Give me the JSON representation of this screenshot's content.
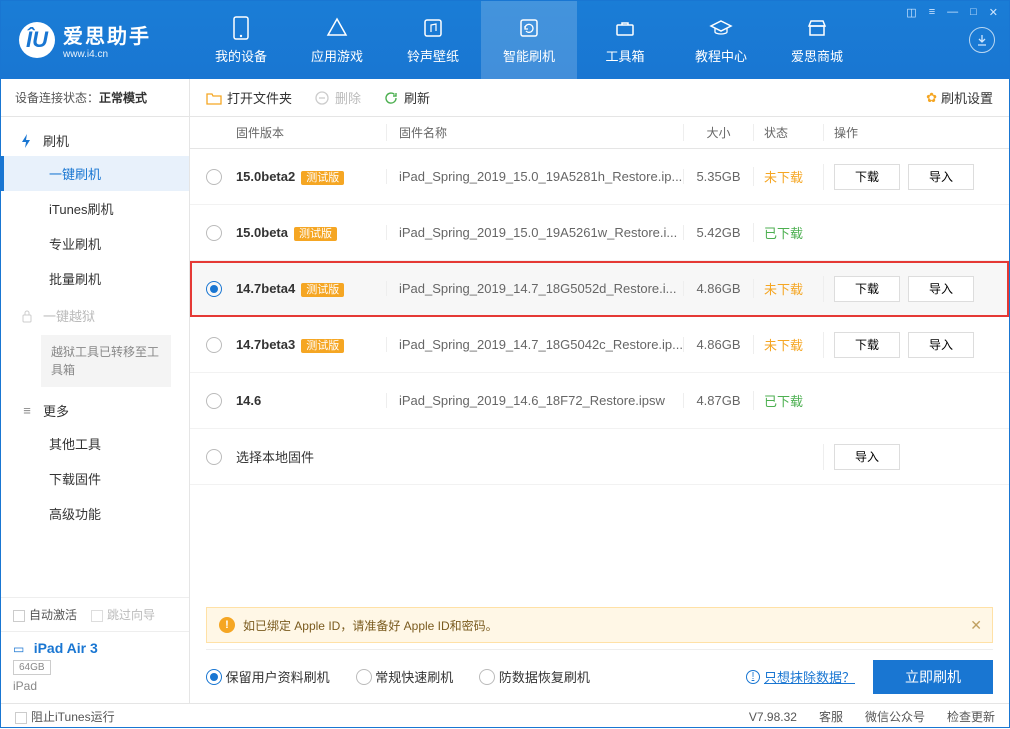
{
  "logo": {
    "name": "爱思助手",
    "url": "www.i4.cn"
  },
  "nav": [
    {
      "label": "我的设备"
    },
    {
      "label": "应用游戏"
    },
    {
      "label": "铃声壁纸"
    },
    {
      "label": "智能刷机"
    },
    {
      "label": "工具箱"
    },
    {
      "label": "教程中心"
    },
    {
      "label": "爱思商城"
    }
  ],
  "conn": {
    "prefix": "设备连接状态：",
    "status": "正常模式"
  },
  "sidebar": {
    "flash_group": "刷机",
    "items": [
      "一键刷机",
      "iTunes刷机",
      "专业刷机",
      "批量刷机"
    ],
    "jb_group": "一键越狱",
    "jb_note": "越狱工具已转移至工具箱",
    "more_group": "更多",
    "more_items": [
      "其他工具",
      "下载固件",
      "高级功能"
    ],
    "auto_activate": "自动激活",
    "skip_guide": "跳过向导",
    "device_name": "iPad Air 3",
    "device_cap": "64GB",
    "device_type": "iPad"
  },
  "toolbar": {
    "open": "打开文件夹",
    "delete": "删除",
    "refresh": "刷新",
    "settings": "刷机设置"
  },
  "table": {
    "head": {
      "ver": "固件版本",
      "name": "固件名称",
      "size": "大小",
      "status": "状态",
      "ops": "操作"
    },
    "beta_tag": "测试版",
    "btn_download": "下载",
    "btn_import": "导入",
    "rows": [
      {
        "ver": "15.0beta2",
        "beta": true,
        "name": "iPad_Spring_2019_15.0_19A5281h_Restore.ip...",
        "size": "5.35GB",
        "status": "未下载",
        "statusCls": "dl",
        "ops": true
      },
      {
        "ver": "15.0beta",
        "beta": true,
        "name": "iPad_Spring_2019_15.0_19A5261w_Restore.i...",
        "size": "5.42GB",
        "status": "已下载",
        "statusCls": "done",
        "ops": false
      },
      {
        "ver": "14.7beta4",
        "beta": true,
        "name": "iPad_Spring_2019_14.7_18G5052d_Restore.i...",
        "size": "4.86GB",
        "status": "未下载",
        "statusCls": "dl",
        "ops": true,
        "selected": true
      },
      {
        "ver": "14.7beta3",
        "beta": true,
        "name": "iPad_Spring_2019_14.7_18G5042c_Restore.ip...",
        "size": "4.86GB",
        "status": "未下载",
        "statusCls": "dl",
        "ops": true
      },
      {
        "ver": "14.6",
        "beta": false,
        "name": "iPad_Spring_2019_14.6_18F72_Restore.ipsw",
        "size": "4.87GB",
        "status": "已下载",
        "statusCls": "done",
        "ops": false
      }
    ],
    "local_row": "选择本地固件"
  },
  "warn": "如已绑定 Apple ID，请准备好 Apple ID和密码。",
  "flash_opts": [
    "保留用户资料刷机",
    "常规快速刷机",
    "防数据恢复刷机"
  ],
  "erase_link": "只想抹除数据？",
  "flash_btn": "立即刷机",
  "footer": {
    "block_itunes": "阻止iTunes运行",
    "version": "V7.98.32",
    "links": [
      "客服",
      "微信公众号",
      "检查更新"
    ]
  }
}
